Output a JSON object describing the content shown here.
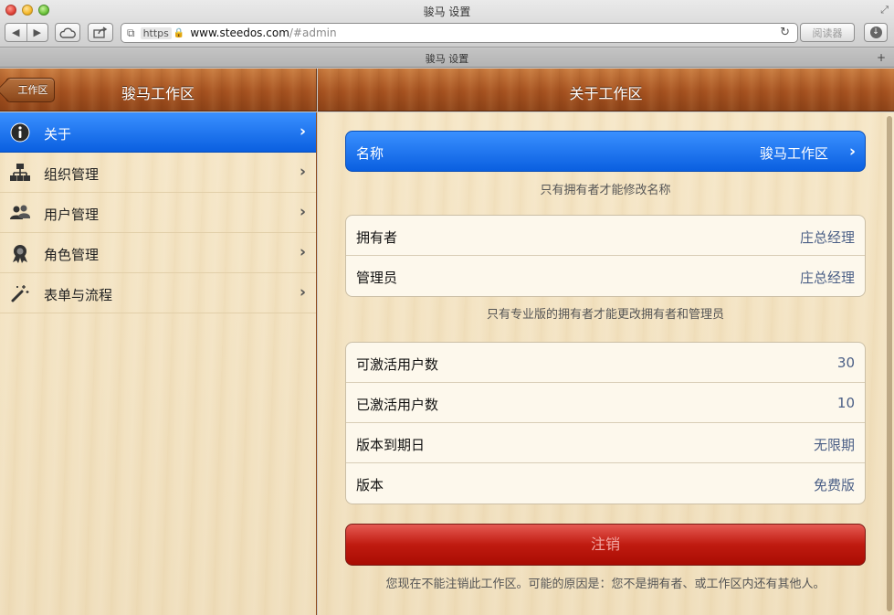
{
  "window": {
    "title": "骏马 设置"
  },
  "browser": {
    "url_scheme": "https",
    "url_host": "www.steedos.com",
    "url_path": "/#admin",
    "reader_label": "阅读器",
    "tab_title": "骏马 设置",
    "tab_add_label": "+"
  },
  "sidebar": {
    "back_label": "工作区",
    "title": "骏马工作区",
    "items": [
      {
        "label": "关于",
        "icon": "info-icon"
      },
      {
        "label": "组织管理",
        "icon": "org-chart-icon"
      },
      {
        "label": "用户管理",
        "icon": "users-icon"
      },
      {
        "label": "角色管理",
        "icon": "badge-icon"
      },
      {
        "label": "表单与流程",
        "icon": "magic-wand-icon"
      }
    ]
  },
  "content": {
    "title": "关于工作区",
    "name_row": {
      "label": "名称",
      "value": "骏马工作区"
    },
    "name_note": "只有拥有者才能修改名称",
    "owner_group": [
      {
        "label": "拥有者",
        "value": "庄总经理"
      },
      {
        "label": "管理员",
        "value": "庄总经理"
      }
    ],
    "owner_note": "只有专业版的拥有者才能更改拥有者和管理员",
    "license_group": [
      {
        "label": "可激活用户数",
        "value": "30"
      },
      {
        "label": "已激活用户数",
        "value": "10"
      },
      {
        "label": "版本到期日",
        "value": "无限期"
      },
      {
        "label": "版本",
        "value": "免费版"
      }
    ],
    "logout_label": "注销",
    "logout_note": "您现在不能注销此工作区。可能的原因是：您不是拥有者、或工作区内还有其他人。"
  },
  "colors": {
    "accent_blue": "#0a5fe0",
    "danger_red": "#c01b10",
    "wood_brown": "#a65220",
    "value_text": "#4b5f86"
  }
}
